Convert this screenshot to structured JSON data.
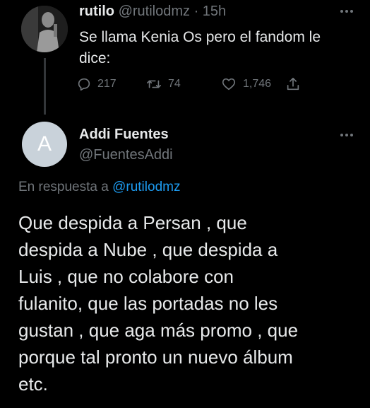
{
  "colors": {
    "background": "#000000",
    "text": "#e7e9ea",
    "secondary": "#71767b",
    "link": "#1d9bf0",
    "divider": "#333639"
  },
  "parent_tweet": {
    "author_name": "rutilo",
    "author_handle": "@rutilodmz",
    "separator": "·",
    "time": "15h",
    "more_icon": "more-horizontal-icon",
    "text_line1": "Se llama Kenia Os pero el fandom le",
    "text_line2": "dice:",
    "replies": "217",
    "retweets": "74",
    "likes": "1,746",
    "icons": {
      "reply": "reply-icon",
      "retweet": "retweet-icon",
      "like": "heart-icon",
      "share": "share-icon"
    }
  },
  "reply_tweet": {
    "avatar_letter": "A",
    "author_name": "Addi Fuentes",
    "author_handle": "@FuentesAddi",
    "more_icon": "more-horizontal-icon",
    "replying_to_prefix": "En respuesta a ",
    "replying_to_handle": "@rutilodmz",
    "text_lines": [
      "Que despida a Persan , que",
      "despida a Nube , que despida a",
      "Luis , que no colabore con",
      "fulanito, que las portadas no les",
      "gustan , que aga más promo , que",
      "porque tal pronto un nuevo álbum",
      "etc."
    ]
  }
}
